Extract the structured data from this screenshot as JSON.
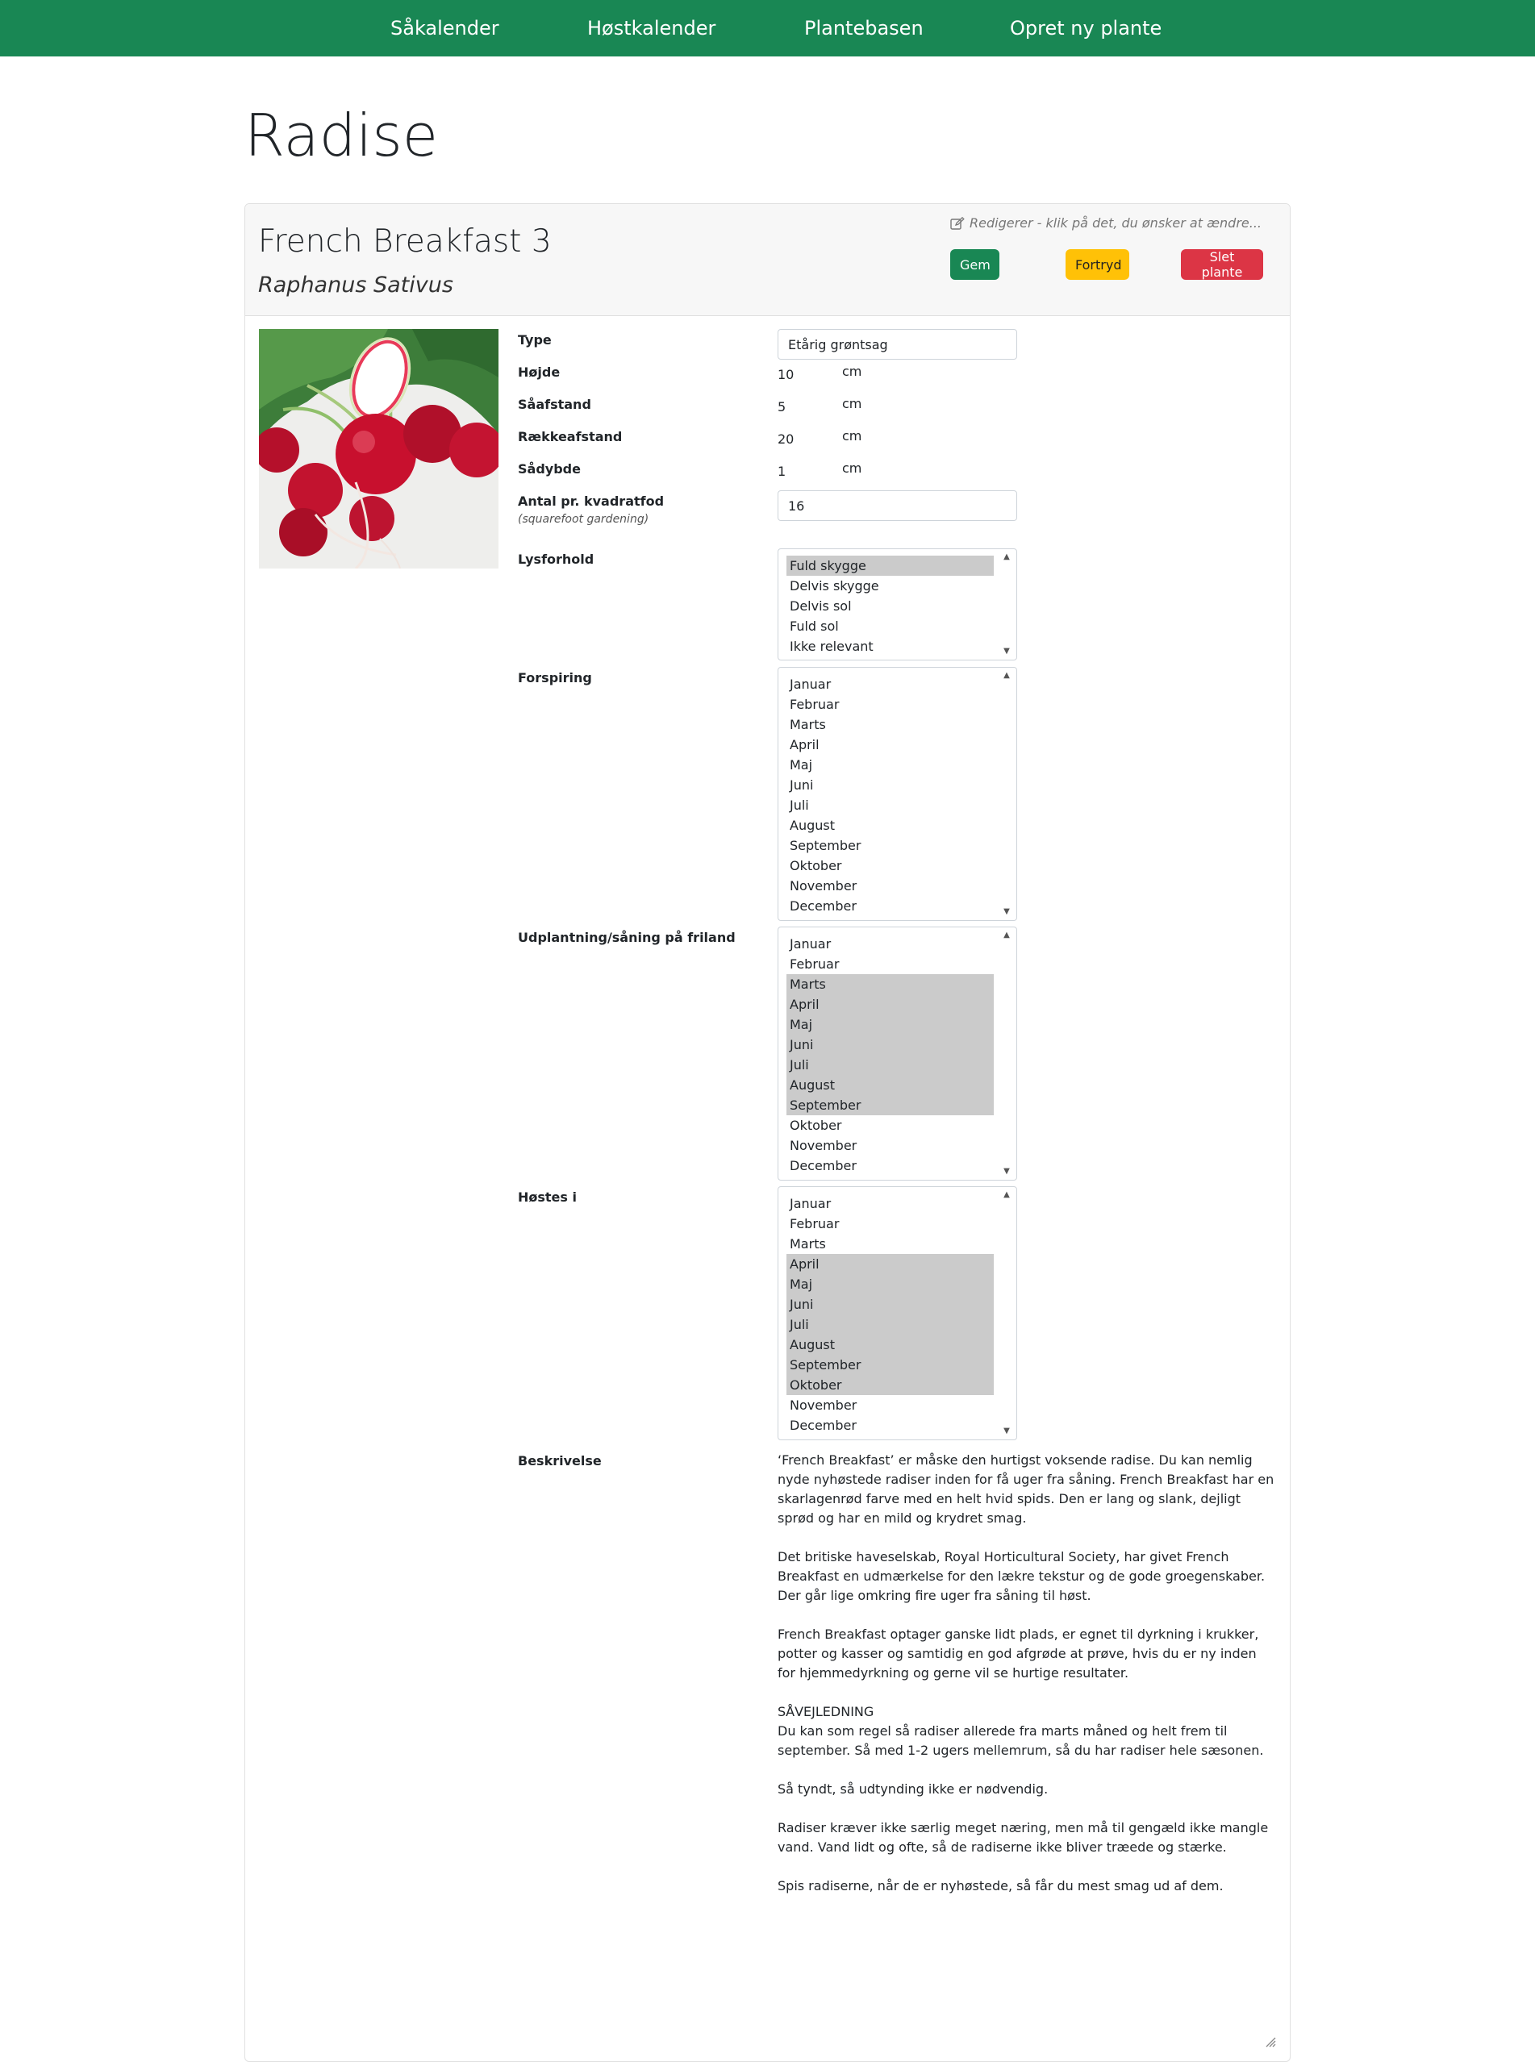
{
  "nav": {
    "items": [
      "Såkalender",
      "Høstkalender",
      "Plantebasen",
      "Opret ny plante"
    ]
  },
  "page": {
    "title": "Radise"
  },
  "header": {
    "variety": "French Breakfast 3",
    "latin_name": "Raphanus Sativus",
    "edit_hint": "Redigerer - klik på det, du ønsker at ændre...",
    "save_label": "Gem",
    "cancel_label": "Fortryd",
    "delete_label": "Slet plante",
    "edit_icon": "edit-icon"
  },
  "image": {
    "subject": "radishes"
  },
  "fields": {
    "type": {
      "label": "Type",
      "value": "Etårig grøntsag"
    },
    "height": {
      "label": "Højde",
      "value": "10",
      "unit": "cm"
    },
    "spacing": {
      "label": "Såafstand",
      "value": "5",
      "unit": "cm"
    },
    "row_spacing": {
      "label": "Rækkeafstand",
      "value": "20",
      "unit": "cm"
    },
    "depth": {
      "label": "Sådybde",
      "value": "1",
      "unit": "cm"
    },
    "per_sqft": {
      "label": "Antal pr. kvadratfod",
      "sub_label": "(squarefoot gardening)",
      "value": "16"
    },
    "light": {
      "label": "Lysforhold",
      "options": [
        "Fuld skygge",
        "Delvis skygge",
        "Delvis sol",
        "Fuld sol",
        "Ikke relevant"
      ],
      "selected": [
        "Fuld skygge"
      ]
    },
    "germination": {
      "label": "Forspiring",
      "options": [
        "Januar",
        "Februar",
        "Marts",
        "April",
        "Maj",
        "Juni",
        "Juli",
        "August",
        "September",
        "Oktober",
        "November",
        "December"
      ],
      "selected": []
    },
    "outdoor": {
      "label": "Udplantning/såning på friland",
      "options": [
        "Januar",
        "Februar",
        "Marts",
        "April",
        "Maj",
        "Juni",
        "Juli",
        "August",
        "September",
        "Oktober",
        "November",
        "December"
      ],
      "selected": [
        "Marts",
        "April",
        "Maj",
        "Juni",
        "Juli",
        "August",
        "September"
      ]
    },
    "harvest": {
      "label": "Høstes i",
      "options": [
        "Januar",
        "Februar",
        "Marts",
        "April",
        "Maj",
        "Juni",
        "Juli",
        "August",
        "September",
        "Oktober",
        "November",
        "December"
      ],
      "selected": [
        "April",
        "Maj",
        "Juni",
        "Juli",
        "August",
        "September",
        "Oktober"
      ]
    },
    "description": {
      "label": "Beskrivelse",
      "p1": "‘French Breakfast’ er måske den hurtigst voksende radise. Du kan nemlig nyde nyhøstede radiser inden for få uger fra såning. French Breakfast har en skarlagenrød farve med en helt hvid spids. Den er lang og slank, dejligt sprød og har en mild og krydret smag.",
      "p2": "Det britiske haveselskab, Royal Horticultural Society, har givet French Breakfast en udmærkelse for den lækre tekstur og de gode groegenskaber. Der går lige omkring fire uger fra såning til høst.",
      "p3": "French Breakfast optager ganske lidt plads, er egnet til dyrkning i krukker, potter og kasser og samtidig en god afgrøde at prøve, hvis du er ny inden for hjemmedyrkning og gerne vil se hurtige resultater.",
      "p4_heading": "SÅVEJLEDNING",
      "p4": "Du kan som regel så radiser allerede fra marts måned og helt frem til september. Så med 1-2 ugers mellemrum, så du har radiser hele sæsonen.",
      "p5": "Så tyndt, så udtynding ikke er nødvendig.",
      "p6": "Radiser kræver ikke særlig meget næring, men må til gengæld ikke mangle vand. Vand lidt og ofte, så de radiserne ikke bliver træede og stærke.",
      "p7": "Spis radiserne, når de er nyhøstede, så får du mest smag ud af dem."
    }
  }
}
